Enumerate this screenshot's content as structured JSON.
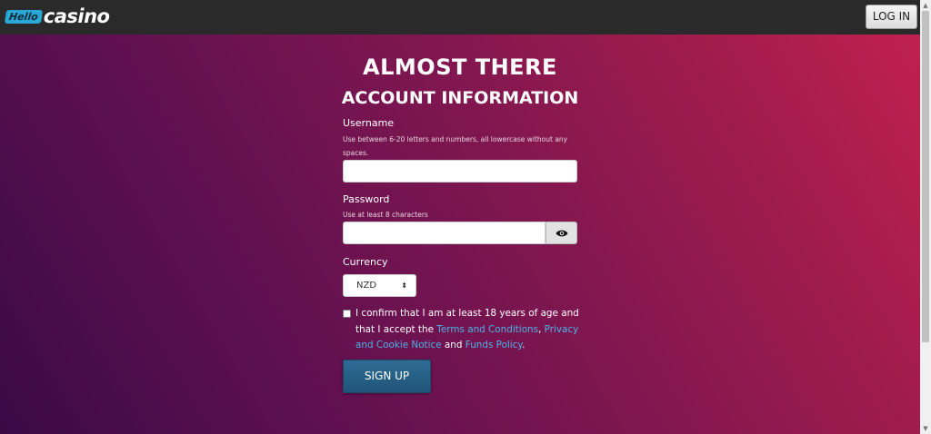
{
  "header": {
    "logo_badge": "Hello",
    "logo_text": "casino",
    "login_label": "LOG IN"
  },
  "form": {
    "title": "ALMOST THERE",
    "subtitle": "ACCOUNT INFORMATION",
    "username": {
      "label": "Username",
      "hint": "Use between 6-20 letters and numbers, all lowercase without any spaces.",
      "value": ""
    },
    "password": {
      "label": "Password",
      "hint": "Use at least 8 characters",
      "value": ""
    },
    "currency": {
      "label": "Currency",
      "selected": "NZD"
    },
    "consent": {
      "checked": false,
      "text_1": "I confirm that I am at least 18 years of age and that I accept the ",
      "link_terms": "Terms and Conditions",
      "sep_1": ", ",
      "link_privacy": "Privacy and Cookie Notice",
      "sep_2": " and ",
      "link_funds": "Funds Policy",
      "end": "."
    },
    "signup_label": "SIGN UP"
  },
  "icons": {
    "eye": "eye-icon",
    "select_arrows": "sort-arrows-icon"
  },
  "colors": {
    "accent_blue": "#29a8d8",
    "link": "#4db3e6",
    "button": "#2f6c95"
  }
}
